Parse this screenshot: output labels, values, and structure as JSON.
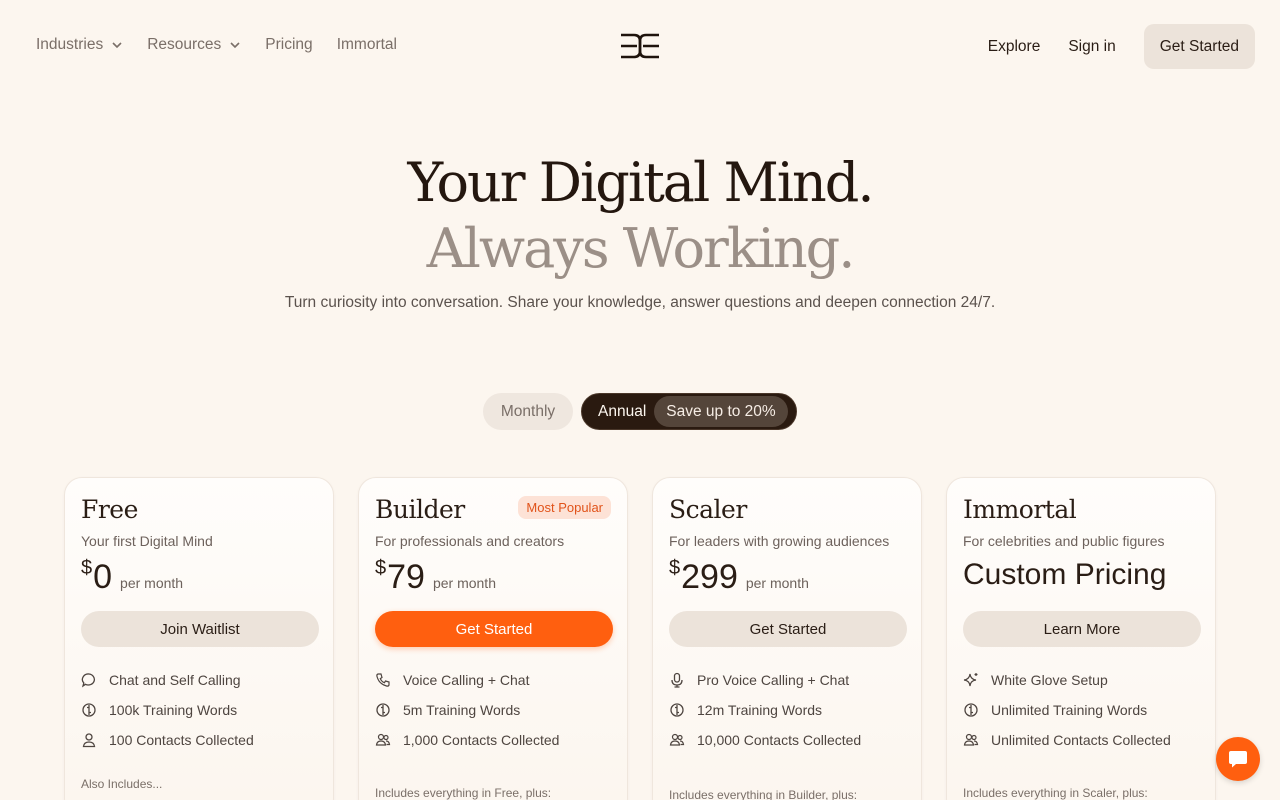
{
  "nav": {
    "left": [
      {
        "label": "Industries",
        "has_menu": true
      },
      {
        "label": "Resources",
        "has_menu": true
      },
      {
        "label": "Pricing",
        "has_menu": false
      },
      {
        "label": "Immortal",
        "has_menu": false
      }
    ],
    "explore": "Explore",
    "signin": "Sign in",
    "cta": "Get Started"
  },
  "hero": {
    "line1": "Your Digital Mind.",
    "line2": "Always Working.",
    "subtitle": "Turn curiosity into conversation. Share your knowledge, answer questions and deepen connection 24/7."
  },
  "billing": {
    "monthly": "Monthly",
    "annual": "Annual",
    "save": "Save up to 20%",
    "selected": "Annual"
  },
  "plans": [
    {
      "name": "Free",
      "desc": "Your first Digital Mind",
      "currency": "$",
      "amount": "0",
      "per": "per month",
      "button": "Join Waitlist",
      "features": [
        {
          "icon": "chat-bubble-icon",
          "text": "Chat and Self Calling"
        },
        {
          "icon": "training-icon",
          "text": "100k Training Words"
        },
        {
          "icon": "person-icon",
          "text": "100 Contacts Collected"
        }
      ],
      "footer": "Also Includes..."
    },
    {
      "name": "Builder",
      "badge": "Most Popular",
      "desc": "For professionals and creators",
      "currency": "$",
      "amount": "79",
      "per": "per month",
      "button": "Get Started",
      "features": [
        {
          "icon": "phone-icon",
          "text": "Voice Calling + Chat"
        },
        {
          "icon": "training-icon",
          "text": "5m Training Words"
        },
        {
          "icon": "people-icon",
          "text": "1,000 Contacts Collected"
        }
      ],
      "footer": "Includes everything in Free, plus:"
    },
    {
      "name": "Scaler",
      "desc": "For leaders with growing audiences",
      "currency": "$",
      "amount": "299",
      "per": "per month",
      "button": "Get Started",
      "features": [
        {
          "icon": "microphone-icon",
          "text": "Pro Voice Calling + Chat"
        },
        {
          "icon": "training-icon",
          "text": "12m Training Words"
        },
        {
          "icon": "people-icon",
          "text": "10,000 Contacts Collected"
        }
      ],
      "footer": "Includes everything in Builder, plus:"
    },
    {
      "name": "Immortal",
      "desc": "For celebrities and public figures",
      "custom_price": "Custom Pricing",
      "button": "Learn More",
      "features": [
        {
          "icon": "sparkle-icon",
          "text": "White Glove Setup"
        },
        {
          "icon": "training-icon",
          "text": "Unlimited Training Words"
        },
        {
          "icon": "people-icon",
          "text": "Unlimited Contacts Collected"
        }
      ],
      "footer": "Includes everything in Scaler, plus:"
    }
  ],
  "colors": {
    "background": "#fcf6ef",
    "accent": "#ff5f0f",
    "dark": "#2a1a10"
  }
}
